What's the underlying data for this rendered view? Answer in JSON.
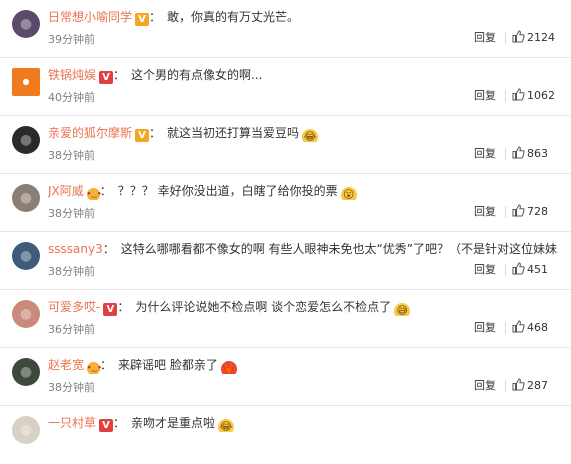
{
  "labels": {
    "reply": "回复"
  },
  "comments": [
    {
      "user": "日常想小喻同学",
      "badge": "V",
      "badge_type": "gold",
      "text": "敢，你真的有万丈光芒。",
      "emoji": "",
      "time": "39分钟前",
      "likes": "2124",
      "avatar_color": "#5b4a6b",
      "avatar_icon": "avatar-photo-icon"
    },
    {
      "user": "铁锅炖娱",
      "badge": "V",
      "badge_type": "red",
      "text": "这个男的有点像女的啊...",
      "emoji": "",
      "time": "40分钟前",
      "likes": "1062",
      "avatar_color": "#f07b1e",
      "avatar_icon": "brand-logo-icon"
    },
    {
      "user": "亲爱的狐尔摩斯",
      "badge": "V",
      "badge_type": "gold",
      "text": "就这当初还打算当爱豆吗",
      "emoji": "laughing-crying-emoji",
      "time": "38分钟前",
      "likes": "863",
      "avatar_color": "#2a2a2a",
      "avatar_icon": "avatar-photo-icon"
    },
    {
      "user": "JX阿威",
      "badge": "face",
      "badge_type": "face",
      "text": "？？？ 幸好你没出道，白瞎了给你投的票",
      "emoji": "shocked-emoji",
      "time": "38分钟前",
      "likes": "728",
      "avatar_color": "#8a7f74",
      "avatar_icon": "avatar-photo-icon"
    },
    {
      "user": "ssssany3",
      "badge": "",
      "badge_type": "",
      "text": "这特么哪哪看都不像女的啊 有些人眼神未免也太“优秀”了吧？（不是针对这位妹妹",
      "emoji": "",
      "time": "38分钟前",
      "likes": "451",
      "avatar_color": "#3e5b7a",
      "avatar_icon": "avatar-photo-icon"
    },
    {
      "user": "可爱多哎-",
      "badge": "V",
      "badge_type": "red",
      "text": "为什么评论说她不检点啊 谈个恋爱怎么不检点了",
      "emoji": "sweat-smile-emoji",
      "time": "36分钟前",
      "likes": "468",
      "avatar_color": "#c98a7a",
      "avatar_icon": "avatar-photo-icon"
    },
    {
      "user": "赵老宽",
      "badge": "face",
      "badge_type": "face",
      "text": "来辟谣吧 脸都亲了",
      "emoji": "crab-emoji",
      "time": "38分钟前",
      "likes": "287",
      "avatar_color": "#3c4a3a",
      "avatar_icon": "avatar-photo-icon"
    },
    {
      "user": "一只村草",
      "badge": "V",
      "badge_type": "red",
      "text": "亲吻才是重点啦",
      "emoji": "laughing-crying-emoji",
      "time": "",
      "likes": "",
      "avatar_color": "#d8d0c4",
      "avatar_icon": "avatar-photo-icon"
    }
  ],
  "colors": {
    "username": "#eb7350",
    "time": "#808080",
    "text": "#333333",
    "badge_gold": "#f5a623",
    "badge_red": "#e04040"
  }
}
